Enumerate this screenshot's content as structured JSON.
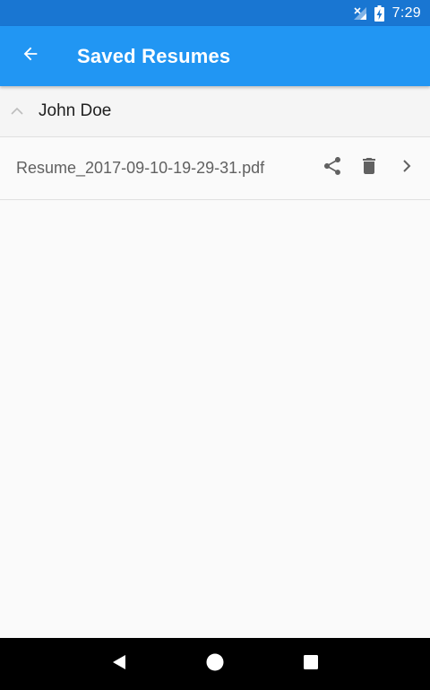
{
  "status_bar": {
    "time": "7:29",
    "icons": [
      "signal-off-icon",
      "battery-charging-icon"
    ]
  },
  "app_bar": {
    "back_icon": "arrow-back-icon",
    "title": "Saved Resumes"
  },
  "groups": [
    {
      "name": "John Doe",
      "expanded": true,
      "files": [
        {
          "filename": "Resume_2017-09-10-19-29-31.pdf",
          "actions": [
            "share-icon",
            "delete-icon",
            "chevron-right-icon"
          ]
        }
      ]
    }
  ],
  "nav_bar": {
    "buttons": [
      "back-triangle-icon",
      "home-circle-icon",
      "recents-square-icon"
    ]
  },
  "colors": {
    "status_bar": "#1976d2",
    "app_bar": "#2196f3",
    "background": "#fafafa",
    "icon_grey": "#616161"
  }
}
